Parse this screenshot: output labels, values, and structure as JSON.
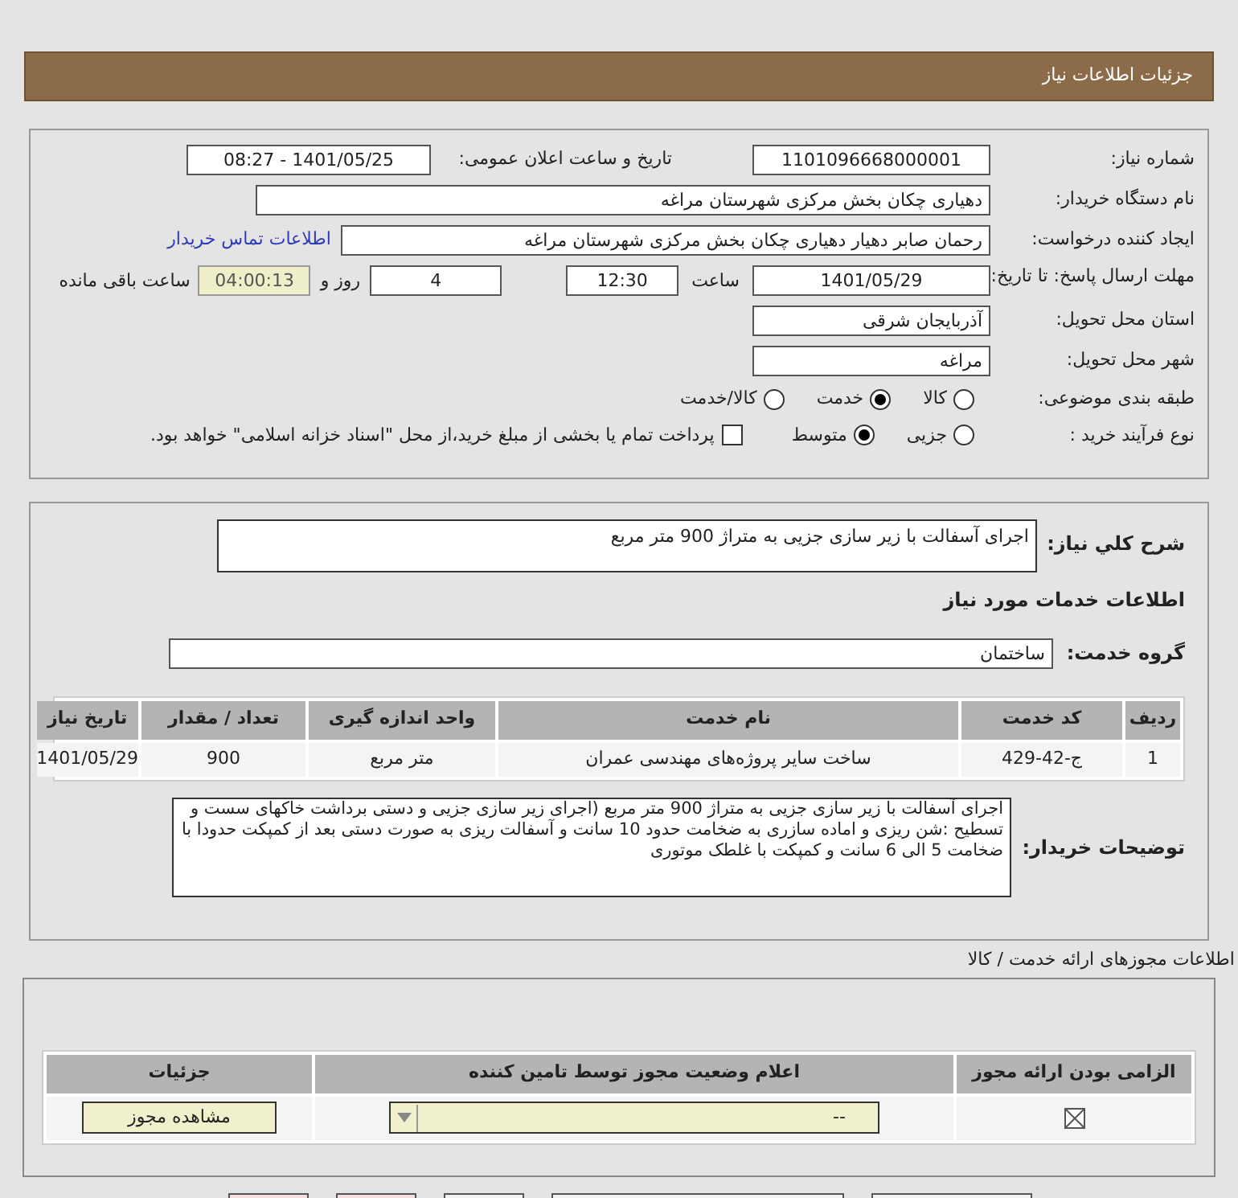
{
  "header": {
    "title": "جزئیات اطلاعات نیاز"
  },
  "details": {
    "need_number": {
      "label": "شماره نیاز:",
      "value": "1101096668000001"
    },
    "announce": {
      "label": "تاریخ و ساعت اعلان عمومی:",
      "value": "1401/05/25 - 08:27"
    },
    "buyer": {
      "label": "نام دستگاه خریدار:",
      "value": "دهیاری چکان بخش مرکزی شهرستان مراغه"
    },
    "creator": {
      "label": "ایجاد کننده درخواست:",
      "value": "رحمان صابر دهیار دهیاری چکان بخش مرکزی شهرستان مراغه",
      "link": "اطلاعات تماس خریدار"
    },
    "deadline": {
      "label": "مهلت ارسال پاسخ: تا تاریخ:",
      "date": "1401/05/29",
      "time_label": "ساعت",
      "time": "12:30",
      "days": "4",
      "days_label": "روز و",
      "remaining": "04:00:13",
      "remaining_label": "ساعت باقی مانده"
    },
    "province": {
      "label": "استان محل تحویل:",
      "value": "آذربایجان شرقی"
    },
    "city": {
      "label": "شهر محل تحویل:",
      "value": "مراغه"
    },
    "category": {
      "label": "طبقه بندی موضوعی:",
      "options": [
        {
          "label": "کالا",
          "selected": false
        },
        {
          "label": "خدمت",
          "selected": true
        },
        {
          "label": "کالا/خدمت",
          "selected": false
        }
      ]
    },
    "process": {
      "label": "نوع فرآیند خرید :",
      "options": [
        {
          "label": "جزیی",
          "selected": false
        },
        {
          "label": "متوسط",
          "selected": true
        }
      ],
      "payment": {
        "label": "پرداخت تمام یا بخشی از مبلغ خرید،از محل \"اسناد خزانه اسلامی\" خواهد بود.",
        "checked": false
      }
    }
  },
  "services": {
    "summary_label": "شرح کلي نياز:",
    "summary": "اجرای آسفالت با زیر سازی جزیی به متراژ 900 متر مربع",
    "section_title": "اطلاعات خدمات مورد نیاز",
    "group_label": "گروه خدمت:",
    "group": "ساختمان",
    "table": {
      "columns": [
        "ردیف",
        "کد خدمت",
        "نام خدمت",
        "واحد اندازه گیری",
        "تعداد / مقدار",
        "تاریخ نیاز"
      ],
      "rows": [
        [
          "1",
          "ج-42-429",
          "ساخت سایر پروژه‌های مهندسی عمران",
          "متر مربع",
          "900",
          "1401/05/29"
        ]
      ]
    },
    "notes_label": "توضیحات خریدار:",
    "notes": "اجرای آسفالت با زیر سازی جزیی به متراژ 900 متر مربع (اجرای زیر سازی جزیی و دستی برداشت خاکهای سست و تسطیح :شن ریزی و اماده سازری به ضخامت حدود 10 سانت و آسفالت ریزی به صورت دستی بعد از کمپکت حدودا با ضخامت 5 الی 6 سانت و کمپکت با غلطک موتوری"
  },
  "permits": {
    "title": "اطلاعات مجوزهای ارائه خدمت / کالا",
    "columns": [
      "الزامی بودن ارائه مجوز",
      "اعلام وضعیت مجوز توسط تامین کننده",
      "جزئیات"
    ],
    "rows": [
      {
        "required": true,
        "status": "--",
        "button": "مشاهده مجوز"
      }
    ]
  }
}
